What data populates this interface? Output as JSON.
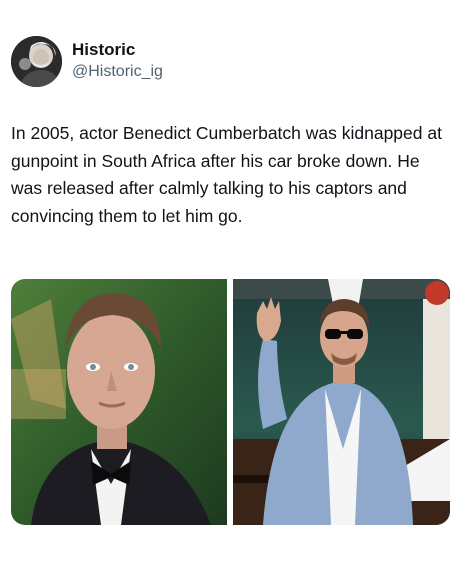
{
  "account": {
    "display_name": "Historic",
    "handle": "@Historic_ig",
    "avatar_icon": "profile-portrait-icon"
  },
  "tweet": {
    "text": "In 2005, actor Benedict Cumberbatch was kidnapped at gunpoint in South Africa after his car broke down. He was released after calmly talking to his captors and convincing them to let him go."
  },
  "media": {
    "photo_left_icon": "portrait-photo",
    "photo_right_icon": "waving-man-photo"
  },
  "colors": {
    "text_primary": "#0f1419",
    "text_secondary": "#536471",
    "background": "#ffffff"
  }
}
